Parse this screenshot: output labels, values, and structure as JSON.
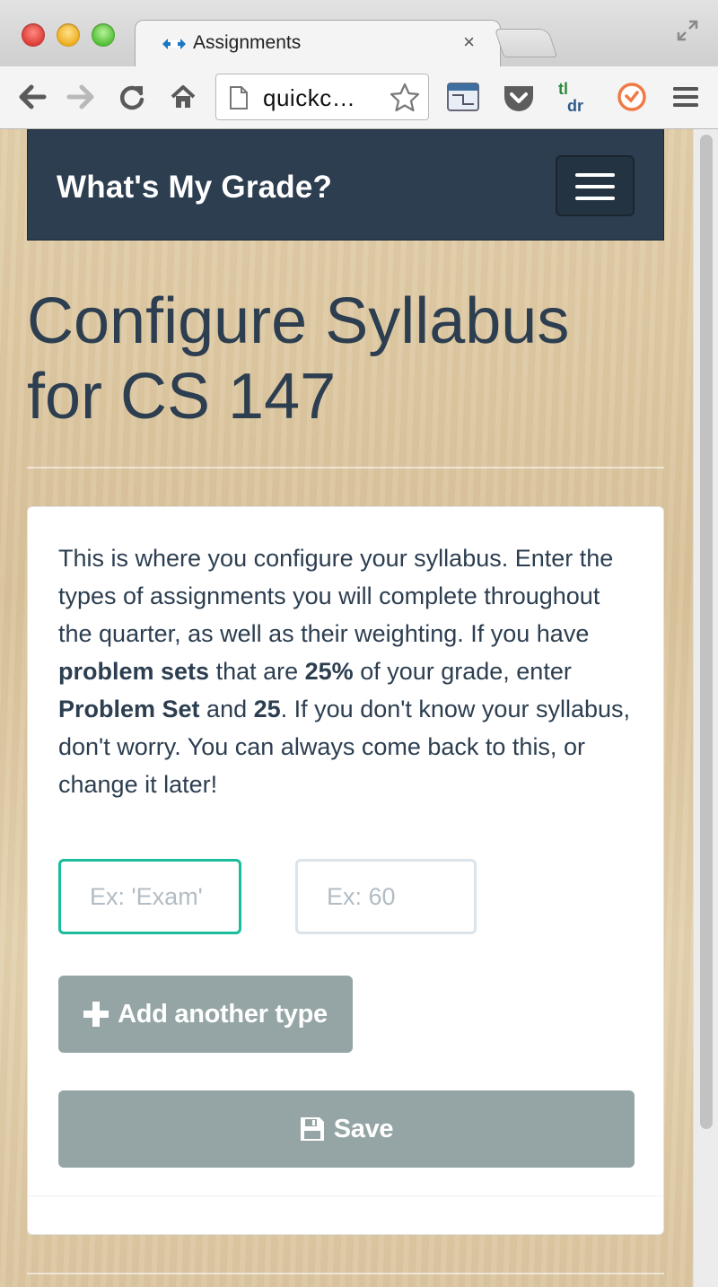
{
  "browser": {
    "tab_title": "Assignments",
    "tab_close": "×",
    "url": "quickc…"
  },
  "navbar": {
    "brand": "What's My Grade?"
  },
  "page": {
    "title_line1": "Configure Syllabus",
    "title_line2": "for CS 147"
  },
  "intro": {
    "t1": "This is where you configure your syllabus. Enter the types of assignments you will complete throughout the quarter, as well as their weighting. If you have ",
    "b1": "problem sets",
    "t2": " that are ",
    "b2": "25%",
    "t3": " of your grade, enter ",
    "b3": "Problem Set",
    "t4": " and ",
    "b4": "25",
    "t5": ". If you don't know your syllabus, don't worry. You can always come back to this, or change it later!"
  },
  "form": {
    "type_placeholder": "Ex: 'Exam'",
    "weight_placeholder": "Ex: 60",
    "add_label": "Add another type",
    "save_label": "Save"
  },
  "colors": {
    "navbar": "#2c3e50",
    "accent_focus": "#1abc9c",
    "button": "#95a5a6"
  },
  "icons": [
    "back-arrow-icon",
    "forward-arrow-icon",
    "reload-icon",
    "home-icon",
    "page-icon",
    "star-icon",
    "plus-icon",
    "floppy-disk-icon",
    "hamburger-icon"
  ]
}
